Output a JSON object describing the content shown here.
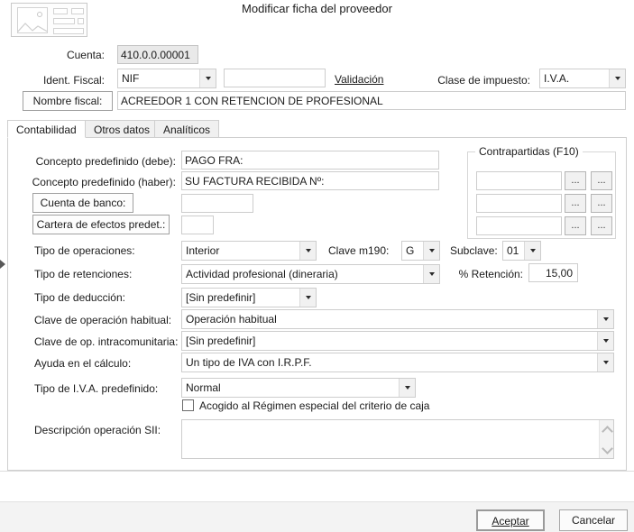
{
  "dialog": {
    "title": "Modificar ficha del proveedor",
    "logo_icon": "image-placeholder-icon"
  },
  "header_fields": {
    "cuenta_label": "Cuenta:",
    "cuenta_value": "410.0.0.00001",
    "ident_fiscal_label": "Ident. Fiscal:",
    "ident_fiscal_type": "NIF",
    "ident_fiscal_value": "",
    "validacion_link": "Validación",
    "clase_impuesto_label": "Clase de impuesto:",
    "clase_impuesto_value": "I.V.A.",
    "nombre_fiscal_button": "Nombre fiscal:",
    "nombre_fiscal_value": "ACREEDOR 1 CON RETENCION DE PROFESIONAL"
  },
  "tabs": [
    {
      "label": "Contabilidad",
      "active": true
    },
    {
      "label": "Otros datos",
      "active": false
    },
    {
      "label": "Analíticos",
      "active": false
    }
  ],
  "contabilidad": {
    "concepto_debe_label": "Concepto predefinido (debe):",
    "concepto_debe_value": "PAGO FRA:",
    "concepto_haber_label": "Concepto predefinido (haber):",
    "concepto_haber_value": "SU FACTURA RECIBIDA Nº:",
    "cuenta_banco_button": "Cuenta de banco:",
    "cuenta_banco_value": "",
    "cartera_efectos_button": "Cartera de efectos predet.:",
    "cartera_efectos_value": "",
    "tipo_operaciones_label": "Tipo de operaciones:",
    "tipo_operaciones_value": "Interior",
    "clave_m190_label": "Clave m190:",
    "clave_m190_value": "G",
    "subclave_label": "Subclave:",
    "subclave_value": "01",
    "tipo_retenciones_label": "Tipo de retenciones:",
    "tipo_retenciones_value": "Actividad profesional (dineraria)",
    "pct_retencion_label": "% Retención:",
    "pct_retencion_value": "15,00",
    "tipo_deduccion_label": "Tipo de deducción:",
    "tipo_deduccion_value": "[Sin predefinir]",
    "clave_op_habitual_label": "Clave de operación habitual:",
    "clave_op_habitual_value": "Operación habitual",
    "clave_op_intra_label": "Clave de op. intracomunitaria:",
    "clave_op_intra_value": "[Sin predefinir]",
    "ayuda_calculo_label": "Ayuda en el cálculo:",
    "ayuda_calculo_value": "Un tipo de IVA con I.R.P.F.",
    "tipo_iva_label": "Tipo de I.V.A. predefinido:",
    "tipo_iva_value": "Normal",
    "regimen_caja_label": "Acogido al Régimen especial del criterio de caja",
    "regimen_caja_checked": false,
    "descripcion_sii_label": "Descripción operación SII:",
    "descripcion_sii_value": ""
  },
  "contrapartidas": {
    "title": "Contrapartidas (F10)",
    "rows": [
      {
        "value": "",
        "btn1": "...",
        "btn2": "..."
      },
      {
        "value": "",
        "btn1": "...",
        "btn2": "..."
      },
      {
        "value": "",
        "btn1": "...",
        "btn2": "..."
      }
    ]
  },
  "footer": {
    "accept_label": "Aceptar",
    "cancel_label": "Cancelar"
  },
  "colors": {
    "window_bg": "#ffffff",
    "field_border": "#cdcdcd",
    "disabled_field_bg": "#e9e9e9",
    "footer_bg": "#f3f3f3",
    "text": "#1b1b1b"
  }
}
